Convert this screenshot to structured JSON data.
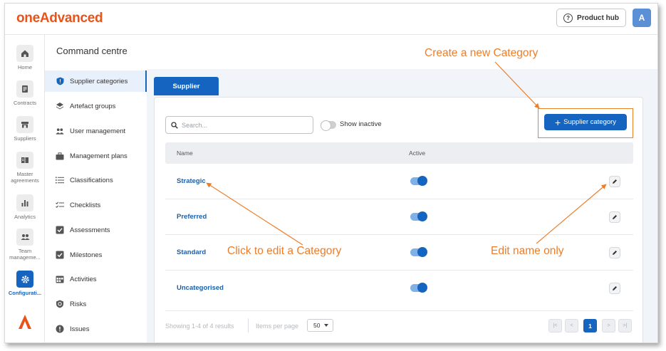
{
  "app": {
    "logo_text": "oneAdvanced",
    "product_hub_label": "Product hub",
    "avatar_initial": "A"
  },
  "rail": {
    "items": [
      {
        "label": "Home",
        "icon": "home-icon"
      },
      {
        "label": "Contracts",
        "icon": "document-icon"
      },
      {
        "label": "Suppliers",
        "icon": "store-icon"
      },
      {
        "label": "Master agreements",
        "icon": "book-icon"
      },
      {
        "label": "Analytics",
        "icon": "bar-chart-icon"
      },
      {
        "label": "Team manageme...",
        "icon": "team-icon"
      },
      {
        "label": "Configurati...",
        "icon": "gear-icon",
        "active": true
      }
    ]
  },
  "subnav": {
    "title": "Command centre",
    "items": [
      {
        "label": "Supplier categories",
        "icon": "shield-icon",
        "active": true
      },
      {
        "label": "Artefact groups",
        "icon": "layers-icon"
      },
      {
        "label": "User management",
        "icon": "users-icon"
      },
      {
        "label": "Management plans",
        "icon": "briefcase-icon"
      },
      {
        "label": "Classifications",
        "icon": "list-icon"
      },
      {
        "label": "Checklists",
        "icon": "checklist-icon"
      },
      {
        "label": "Assessments",
        "icon": "check-square-icon"
      },
      {
        "label": "Milestones",
        "icon": "milestone-icon"
      },
      {
        "label": "Activities",
        "icon": "calendar-icon"
      },
      {
        "label": "Risks",
        "icon": "risk-icon"
      },
      {
        "label": "Issues",
        "icon": "alert-icon"
      }
    ]
  },
  "main": {
    "tab_label": "Supplier",
    "search_placeholder": "Search...",
    "show_inactive_label": "Show inactive",
    "add_button_label": "Supplier category",
    "columns": {
      "name": "Name",
      "active": "Active"
    },
    "rows": [
      {
        "name": "Strategic",
        "active": true
      },
      {
        "name": "Preferred",
        "active": true
      },
      {
        "name": "Standard",
        "active": true
      },
      {
        "name": "Uncategorised",
        "active": true
      }
    ],
    "footer": {
      "showing": "Showing 1-4 of 4 results",
      "items_per_page_label": "Items per page",
      "items_per_page_value": "50",
      "current_page": "1"
    }
  },
  "annotations": {
    "create": "Create a new Category",
    "click_edit": "Click to edit a Category",
    "edit_name": "Edit name only"
  },
  "colors": {
    "brand_orange": "#e8531a",
    "accent_blue": "#1565c0",
    "annotation_orange": "#ee7d2a"
  }
}
